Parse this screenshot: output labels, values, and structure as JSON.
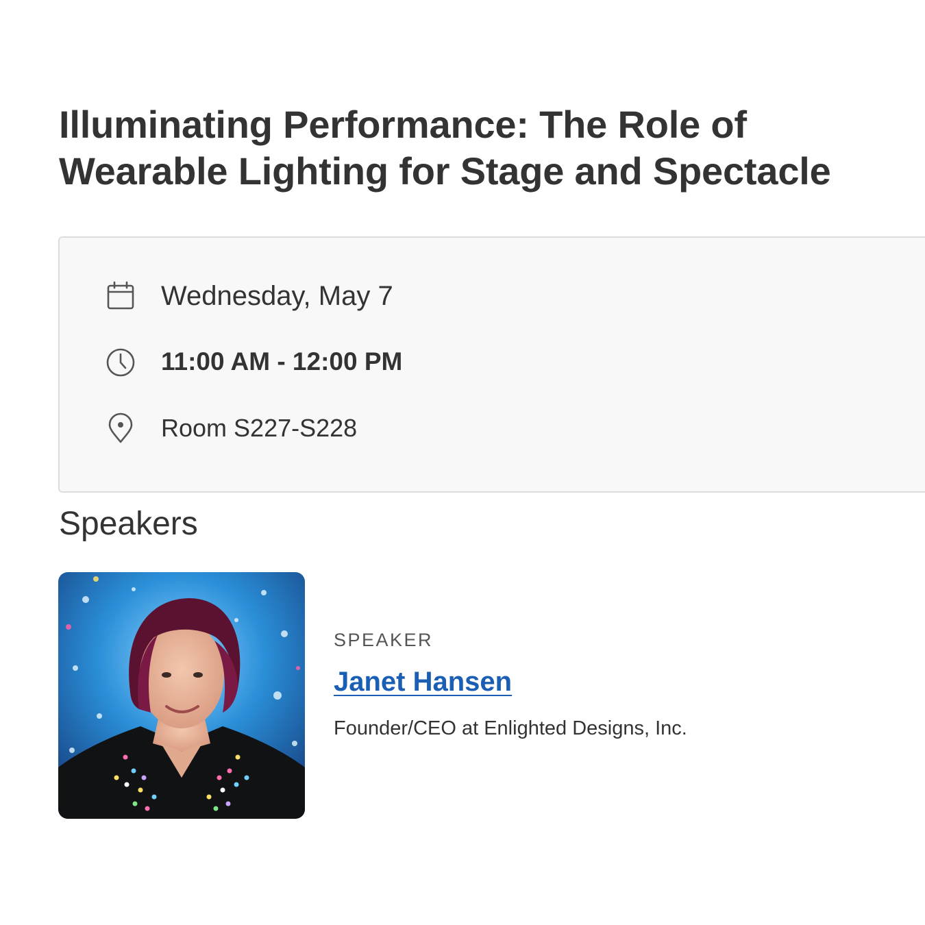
{
  "session": {
    "title": "Illuminating Performance: The Role of Wearable Lighting for Stage and Spectacle"
  },
  "details": {
    "date": "Wednesday, May 7",
    "date_icon": "calendar-icon",
    "time": "11:00 AM - 12:00 PM",
    "time_icon": "clock-icon",
    "location": "Room S227-S228",
    "location_icon": "map-pin-icon"
  },
  "speakers": {
    "heading": "Speakers",
    "items": [
      {
        "role": "SPEAKER",
        "name": "Janet Hansen",
        "title": "Founder/CEO at Enlighted Designs, Inc."
      }
    ]
  },
  "colors": {
    "text": "#333333",
    "link": "#1a5fb4",
    "card_bg": "#f8f8f8",
    "card_border": "#dcdcdc"
  }
}
